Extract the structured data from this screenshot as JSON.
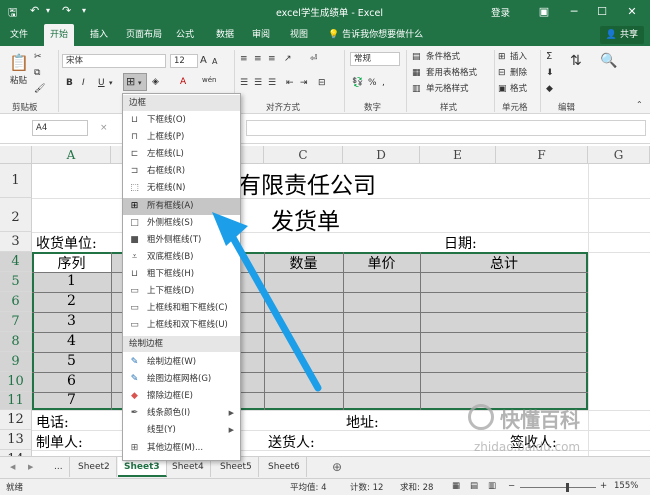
{
  "title_bar": {
    "title": "excel学生成绩单  -  Excel",
    "login": "登录",
    "restore_icon": "ribbon-display-icon",
    "minimize": "─",
    "maximize": "☐",
    "close": "✕"
  },
  "tabs": {
    "file": "文件",
    "home": "开始",
    "insert": "插入",
    "page_layout": "页面布局",
    "formulas": "公式",
    "data": "数据",
    "review": "审阅",
    "view": "视图",
    "tell_me": "告诉我你想要做什么",
    "share": "共享"
  },
  "ribbon": {
    "clipboard": {
      "label": "剪贴板",
      "paste": "粘贴"
    },
    "font": {
      "name": "宋体",
      "size": "12",
      "bold": "B",
      "italic": "I",
      "underline": "U",
      "grow": "A",
      "shrink": "A",
      "font_color": "A",
      "wen": "wén"
    },
    "alignment": {
      "label": "对齐方式"
    },
    "number": {
      "label": "数字",
      "format": "常规",
      "pct": "%"
    },
    "styles": {
      "label": "样式",
      "conditional": "条件格式",
      "table": "套用表格格式",
      "cell_styles": "单元格样式"
    },
    "cells": {
      "label": "单元格",
      "insert": "插入",
      "delete": "删除",
      "format": "格式"
    },
    "editing": {
      "label": "编辑",
      "sum": "Σ"
    }
  },
  "formula_bar": {
    "name_box": "A4",
    "cancel": "×",
    "fx": "fx"
  },
  "grid": {
    "columns": [
      "A",
      "B",
      "C",
      "D",
      "E",
      "F",
      "G"
    ],
    "rows": [
      "1",
      "2",
      "3",
      "4",
      "5",
      "6",
      "7",
      "8",
      "9",
      "10",
      "11",
      "12",
      "13",
      "14"
    ],
    "cells": {
      "company": "有限责任公司",
      "invoice": "发货单",
      "receiver_unit": "收货单位:",
      "date": "日期:",
      "col_seq": "序列",
      "col_qty": "数量",
      "col_price": "单价",
      "col_total": "总计",
      "seq": [
        "1",
        "2",
        "3",
        "4",
        "5",
        "6",
        "7"
      ],
      "phone": "电话:",
      "address": "地址:",
      "maker": "制单人:",
      "sender": "送货人:",
      "signer": "签收人:"
    }
  },
  "sheet_tabs": {
    "prev": "◀",
    "next": "▶",
    "more": "...",
    "sheets": [
      "Sheet2",
      "Sheet3",
      "Sheet4",
      "Sheet5",
      "Sheet6"
    ],
    "active": "Sheet3",
    "add": "⊕"
  },
  "status_bar": {
    "ready": "就绪",
    "average": "平均值: 4",
    "count": "计数: 12",
    "sum": "求和: 28",
    "zoom": "155%"
  },
  "border_menu": {
    "header_borders": "边框",
    "items": [
      "下框线(O)",
      "上框线(P)",
      "左框线(L)",
      "右框线(R)",
      "无框线(N)",
      "所有框线(A)",
      "外侧框线(S)",
      "粗外侧框线(T)",
      "双底框线(B)",
      "粗下框线(H)",
      "上下框线(D)",
      "上框线和粗下框线(C)",
      "上框线和双下框线(U)"
    ],
    "highlighted": "所有框线(A)",
    "header_draw": "绘制边框",
    "draw_items": [
      "绘制边框(W)",
      "绘图边框网格(G)",
      "擦除边框(E)",
      "线条颜色(I)",
      "线型(Y)",
      "其他边框(M)..."
    ]
  },
  "watermark": {
    "text": "快懂百科",
    "url": "zhidao.baidu.com"
  },
  "colors": {
    "excel_green": "#217346",
    "selection_fill": "#d4d4d4",
    "arrow_blue": "#1c9ee8"
  }
}
